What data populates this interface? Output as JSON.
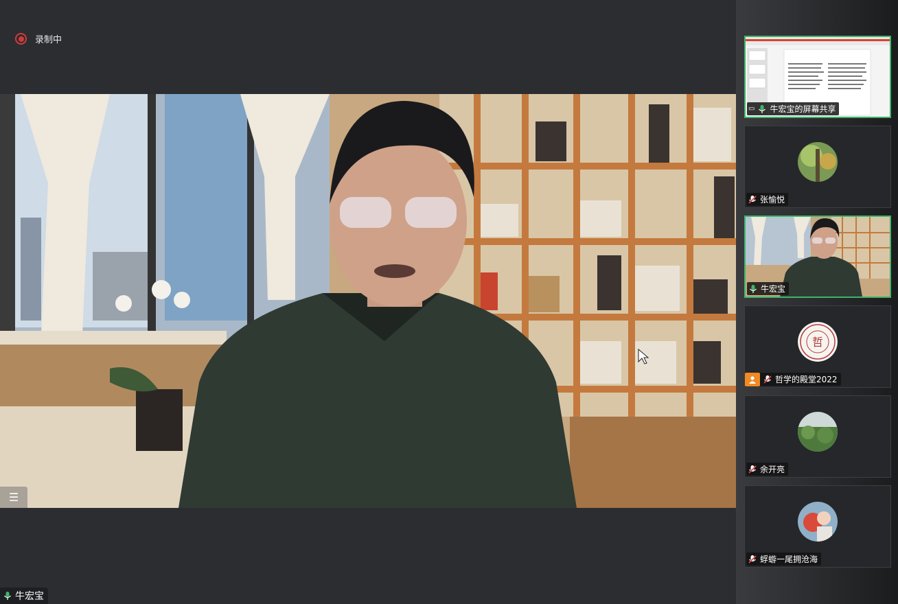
{
  "recording": {
    "label": "录制中",
    "color": "#d23b3b"
  },
  "main_video": {
    "speaker_name": "牛宏宝",
    "list_icon": "list-icon"
  },
  "participants": [
    {
      "name": "牛宏宝的屏幕共享",
      "mic": "on",
      "type": "screen-share"
    },
    {
      "name": "张愉悦",
      "mic": "muted",
      "type": "avatar"
    },
    {
      "name": "牛宏宝",
      "mic": "on",
      "type": "video",
      "active": true
    },
    {
      "name": "哲学的殿堂2022",
      "mic": "muted",
      "type": "logo",
      "host_badge": "user-icon"
    },
    {
      "name": "余开亮",
      "mic": "muted",
      "type": "avatar"
    },
    {
      "name": "蜉蝣一尾拥沧海",
      "mic": "muted",
      "type": "avatar"
    }
  ],
  "colors": {
    "accent_active": "#3fb56a",
    "mic_on": "#3fb56a",
    "mic_muted": "#e04848",
    "host_badge": "#f08a24"
  }
}
